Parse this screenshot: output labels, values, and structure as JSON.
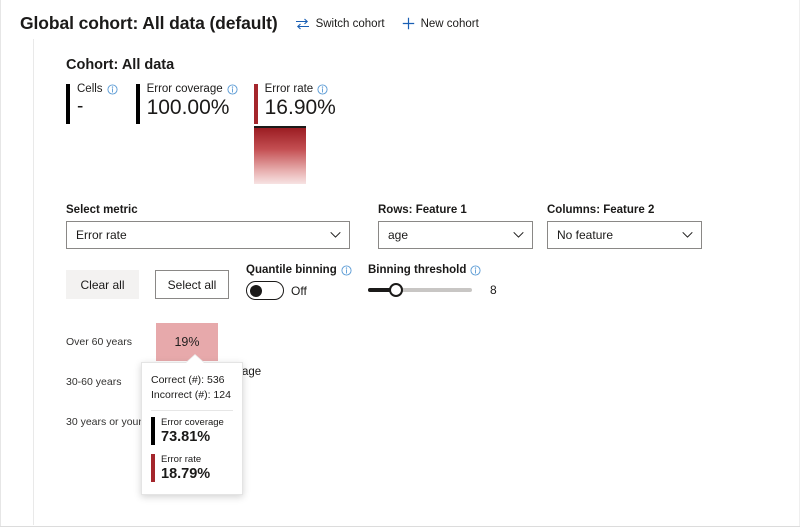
{
  "header": {
    "title": "Global cohort: All data (default)",
    "actions": [
      {
        "label": "Switch cohort",
        "icon": "swap-icon"
      },
      {
        "label": "New cohort",
        "icon": "plus-icon"
      }
    ]
  },
  "cohort": {
    "title": "Cohort: All data",
    "stats": [
      {
        "label": "Cells",
        "value": "-",
        "bar_color": "#000000",
        "info": "info-icon"
      },
      {
        "label": "Error coverage",
        "value": "100.00%",
        "bar_color": "#000000",
        "info": "info-icon"
      },
      {
        "label": "Error rate",
        "value": "16.90%",
        "bar_color": "#a4262c",
        "info": "info-icon"
      }
    ],
    "gradient": {
      "from": "#9b1d23",
      "to": "#f7e3e3"
    }
  },
  "controls": {
    "metric": {
      "label": "Select metric",
      "value": "Error rate"
    },
    "rows": {
      "label": "Rows: Feature 1",
      "value": "age"
    },
    "columns": {
      "label": "Columns: Feature 2",
      "value": "No feature"
    },
    "clear_all": "Clear all",
    "select_all": "Select all",
    "quantile_binning": {
      "label": "Quantile binning",
      "state": "Off",
      "on": false
    },
    "binning_threshold": {
      "label": "Binning threshold",
      "value": "8",
      "percent": 27
    }
  },
  "matrix": {
    "axis_label": "age",
    "rows": [
      {
        "label": "Over 60 years",
        "cell_text": "19%",
        "cell_color": "#e7a9ab"
      },
      {
        "label": "30-60 years",
        "cell_text": "",
        "cell_color": "#e2a0a3"
      },
      {
        "label": "30 years or younger",
        "cell_text": "",
        "cell_color": "#ffffff"
      }
    ]
  },
  "tooltip": {
    "correct": "Correct (#): 536",
    "incorrect": "Incorrect (#): 124",
    "stats": [
      {
        "label": "Error coverage",
        "value": "73.81%",
        "bar_color": "#000000"
      },
      {
        "label": "Error rate",
        "value": "18.79%",
        "bar_color": "#a4262c"
      }
    ]
  },
  "colors": {
    "accent": "#1a5fb4",
    "error_red": "#a4262c",
    "info_blue": "#5b9bd5"
  }
}
